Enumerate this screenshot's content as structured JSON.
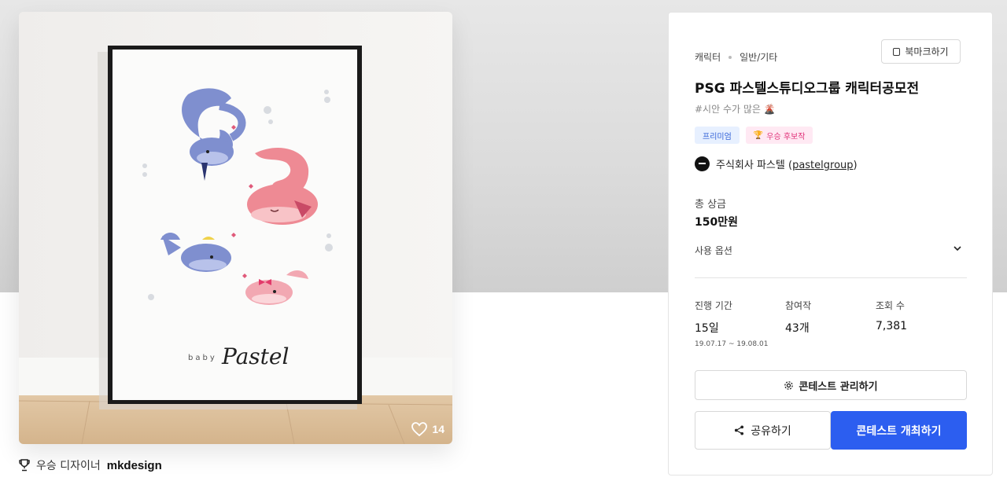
{
  "artwork": {
    "likes": "14",
    "image_text": "baby Pastel",
    "designer_prefix": "우승 디자이너",
    "designer_name": "mkdesign"
  },
  "panel": {
    "category": [
      "캐릭터",
      "일반/기타"
    ],
    "bookmark_label": "북마크하기",
    "title": "PSG 파스텔스튜디오그룹 캐릭터공모전",
    "hashtag": "#시안 수가 많은 🌋",
    "badges": [
      {
        "label": "프리미엄"
      },
      {
        "label": "우승 후보작",
        "icon": "trophy-icon"
      }
    ],
    "host": {
      "name": "주식회사 파스텔 (",
      "handle": "pastelgroup",
      "suffix": ")"
    },
    "prize_label": "총 상금",
    "prize_value": "150만원",
    "usage_label": "사용 옵션",
    "stats": [
      {
        "label": "진행 기간",
        "value": "15일",
        "sub": "19.07.17  ~  19.08.01"
      },
      {
        "label": "참여작",
        "value": "43개",
        "sub": ""
      },
      {
        "label": "조회 수",
        "value": "7,381",
        "sub": ""
      }
    ],
    "manage_label": "콘테스트 관리하기",
    "share_label": "공유하기",
    "host_label": "콘테스트 개최하기"
  },
  "colors": {
    "primary": "#2c5ef0",
    "premium_bg": "#e7f0ff",
    "winner_bg": "#ffe9f3",
    "whale_blue": "#7f8fcf",
    "whale_pink": "#ee8a94"
  }
}
